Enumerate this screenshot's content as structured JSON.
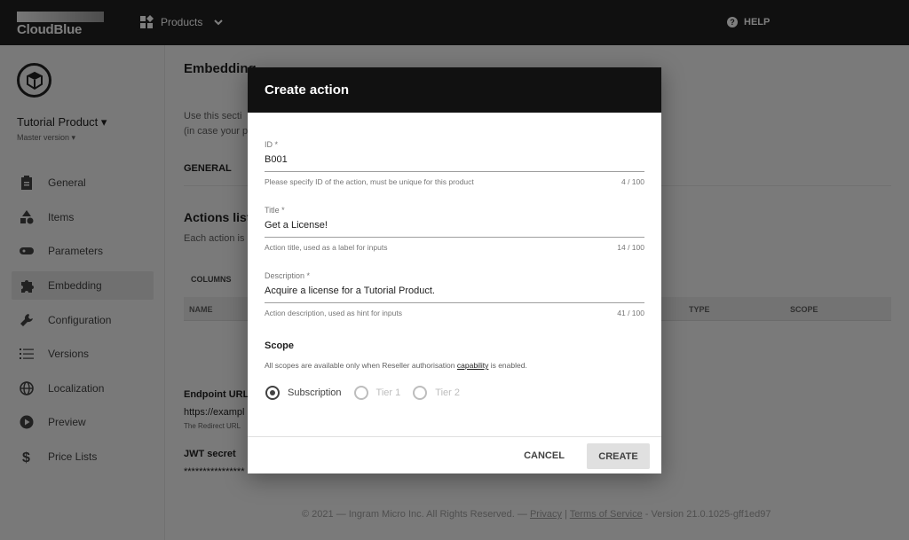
{
  "topbar": {
    "logo": "CloudBlue",
    "products_label": "Products",
    "help_label": "HELP"
  },
  "sidebar": {
    "product_name": "Tutorial Product ▾",
    "version": "Master version ▾",
    "items": [
      {
        "label": "General",
        "icon": "clipboard-icon"
      },
      {
        "label": "Items",
        "icon": "shapes-icon"
      },
      {
        "label": "Parameters",
        "icon": "parameters-icon"
      },
      {
        "label": "Embedding",
        "icon": "puzzle-icon",
        "active": true
      },
      {
        "label": "Configuration",
        "icon": "wrench-icon"
      },
      {
        "label": "Versions",
        "icon": "list-icon"
      },
      {
        "label": "Localization",
        "icon": "globe-icon"
      },
      {
        "label": "Preview",
        "icon": "play-icon"
      },
      {
        "label": "Price Lists",
        "icon": "dollar-icon"
      }
    ]
  },
  "main": {
    "title": "Embedding",
    "desc_line1": "Use this secti",
    "desc_line2": "(in case your p",
    "tab_general": "GENERAL",
    "actions_title": "Actions list",
    "actions_desc": "Each action is",
    "columns_label": "COLUMNS",
    "col_name": "NAME",
    "col_type": "TYPE",
    "col_scope": "SCOPE",
    "endpoint_label": "Endpoint URL",
    "endpoint_value": "https://exampl",
    "endpoint_help": "The Redirect URL",
    "jwt_label": "JWT secret",
    "jwt_value": "****************",
    "footer": {
      "copyright": "© 2021 — Ingram Micro Inc. All Rights Reserved. —",
      "privacy": "Privacy",
      "sep": "|",
      "terms": "Terms of Service",
      "version": "- Version 21.0.1025-gff1ed97"
    }
  },
  "dialog": {
    "title": "Create action",
    "fields": [
      {
        "label": "ID *",
        "value": "B001",
        "help": "Please specify ID of the action, must be unique for this product",
        "counter": "4 / 100"
      },
      {
        "label": "Title *",
        "value": "Get a License!",
        "help": "Action title, used as a label for inputs",
        "counter": "14 / 100"
      },
      {
        "label": "Description *",
        "value": "Acquire a license for a Tutorial Product.",
        "help": "Action description, used as hint for inputs",
        "counter": "41 / 100"
      }
    ],
    "scope_title": "Scope",
    "scope_desc_pre": "All scopes are available only when Reseller authorisation",
    "scope_desc_link": "capability",
    "scope_desc_post": "is enabled.",
    "radios": [
      {
        "label": "Subscription",
        "checked": true
      },
      {
        "label": "Tier 1",
        "checked": false
      },
      {
        "label": "Tier 2",
        "checked": false
      }
    ],
    "cancel_label": "CANCEL",
    "create_label": "CREATE"
  }
}
